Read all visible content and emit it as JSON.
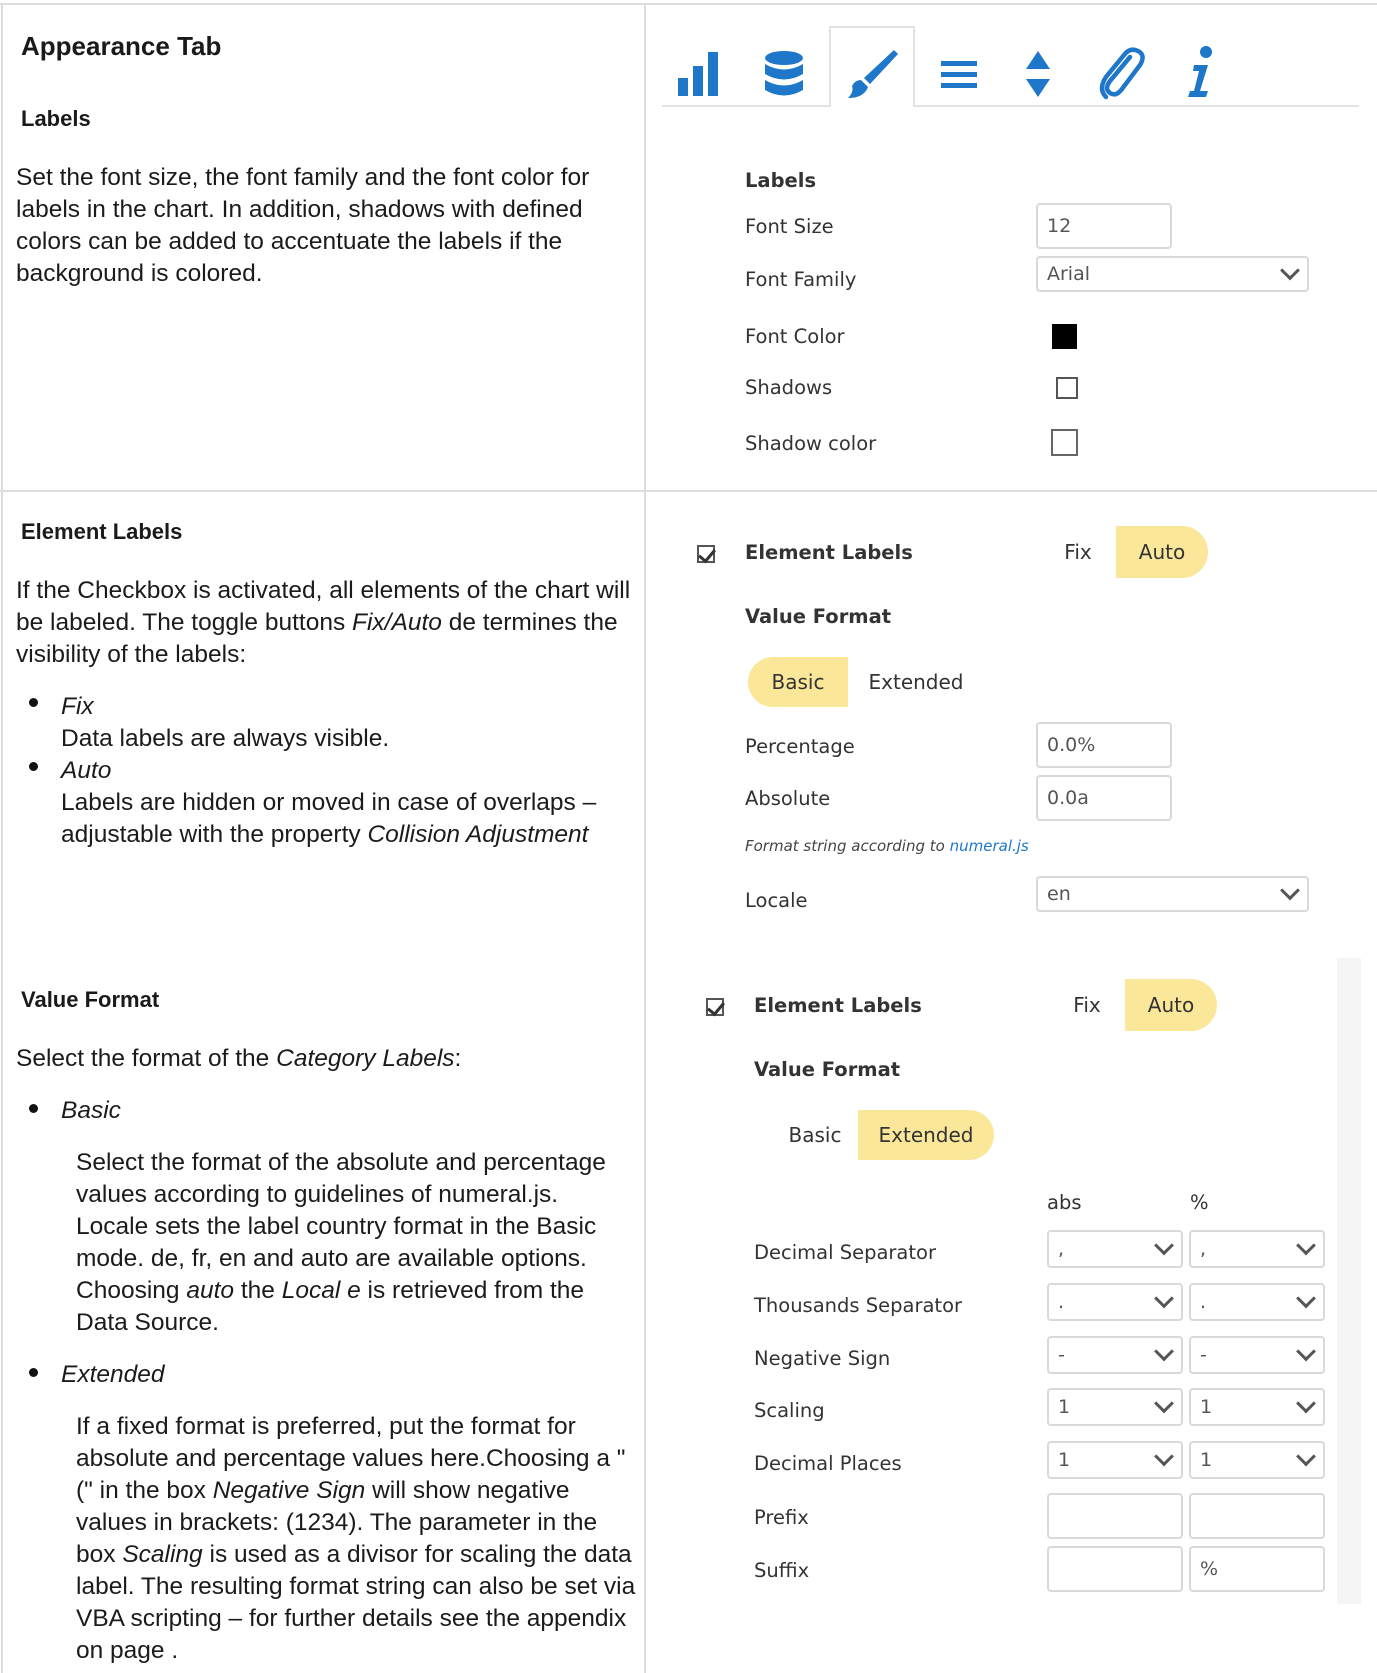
{
  "left": {
    "appearance_title": "Appearance Tab",
    "labels_title": "Labels",
    "labels_text": "Set the font size, the font family and the font color for labels in the chart. In addition, shadows with defined colors can be added to accentuate the labels if the background is colored.",
    "element_labels_title": "Element Labels",
    "el_p1": "If the Checkbox is activated, all elements of the chart will be labeled. The toggle buttons",
    "el_p1_italic": "Fix/Auto",
    "el_p1_end": "de termines the visibility of the labels:",
    "fix_title": "Fix",
    "fix_text": "Data labels are always visible.",
    "auto_title": "Auto",
    "auto_text_1": "Labels are hidden or moved in case of overlaps – adjustable with the property",
    "auto_text_italic": "Collision Adjustment",
    "value_format_title": "Value Format",
    "vf_p1": "Select the format of the",
    "vf_p1_italic": "Category Labels",
    "vf_p1_end": ":",
    "basic_title": "Basic",
    "basic_text_1": "Select the format of the absolute and percentage values according to guidelines of numeral.js. Locale sets the label country format in the Basic mode. de, fr, en and auto are available options. Choosing",
    "basic_text_auto": "auto",
    "basic_text_2": "the",
    "basic_text_local": "Local e",
    "basic_text_3": "is retrieved from the Data Source.",
    "extended_title": "Extended",
    "ext_text_1": "If a fixed format is preferred, put the format for absolute and percentage values here.Choosing a \"(\" in the box",
    "ext_text_neg": "Negative Sign",
    "ext_text_2": "will show negative values in brackets: (1234). The parameter in the box",
    "ext_text_scaling": "Scaling",
    "ext_text_3": "is used as a divisor for scaling the data label. The resulting format string can also be set via VBA scripting – for further details see the appendix on page ."
  },
  "tabs": [
    "chart-icon",
    "database-icon",
    "brush-icon",
    "menu-icon",
    "sort-icon",
    "paperclip-icon",
    "info-icon"
  ],
  "tab_active_index": 2,
  "tab_color": "#1f77c9",
  "panel1": {
    "section": "Labels",
    "font_size_label": "Font Size",
    "font_size_value": "12",
    "font_family_label": "Font Family",
    "font_family_value": "Arial",
    "font_color_label": "Font Color",
    "font_color_value": "#000000",
    "shadows_label": "Shadows",
    "shadow_color_label": "Shadow color"
  },
  "panel2": {
    "element_labels": "Element Labels",
    "fix": "Fix",
    "auto": "Auto",
    "value_format": "Value Format",
    "basic": "Basic",
    "extended": "Extended",
    "percentage_label": "Percentage",
    "percentage_value": "0.0%",
    "absolute_label": "Absolute",
    "absolute_value": "0.0a",
    "hint_prefix": "Format string according to",
    "hint_link": "numeral.js",
    "locale_label": "Locale",
    "locale_value": "en"
  },
  "panel3": {
    "element_labels": "Element Labels",
    "fix": "Fix",
    "auto": "Auto",
    "value_format": "Value Format",
    "basic": "Basic",
    "extended": "Extended",
    "col_abs": "abs",
    "col_pct": "%",
    "rows": [
      {
        "label": "Decimal Separator",
        "abs": ",",
        "pct": ","
      },
      {
        "label": "Thousands Separator",
        "abs": ".",
        "pct": "."
      },
      {
        "label": "Negative Sign",
        "abs": "-",
        "pct": "-"
      },
      {
        "label": "Scaling",
        "abs": "1",
        "pct": "1"
      },
      {
        "label": "Decimal Places",
        "abs": "1",
        "pct": "1"
      }
    ],
    "prefix_label": "Prefix",
    "suffix_label": "Suffix",
    "suffix_pct_value": "%"
  }
}
